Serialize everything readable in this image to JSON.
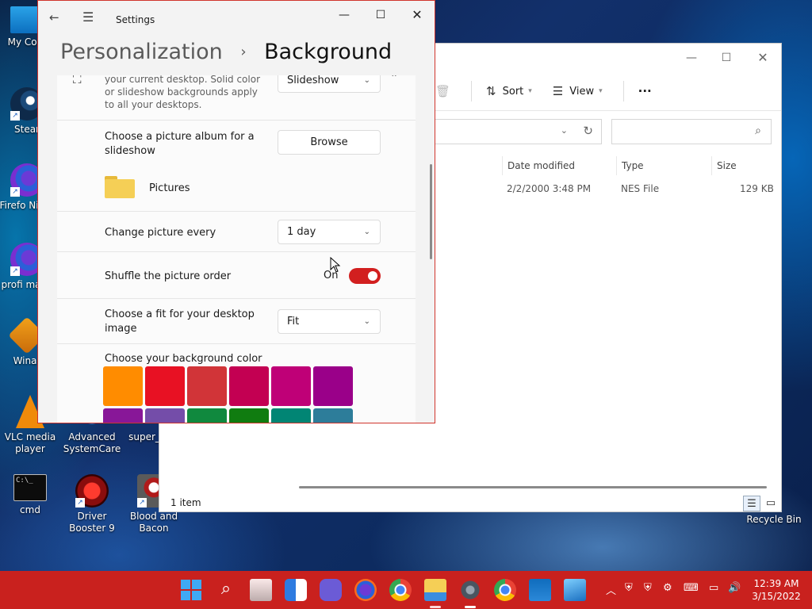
{
  "desktop": {
    "icons": [
      {
        "label": "My Com"
      },
      {
        "label": "Stear"
      },
      {
        "label": "Firefo Night"
      },
      {
        "label": "profi mana"
      },
      {
        "label": "Winar"
      },
      {
        "label": "VLC media player"
      },
      {
        "label": "Advanced SystemCare"
      },
      {
        "label": "super_"
      },
      {
        "label": "cmd"
      },
      {
        "label": "Driver Booster 9"
      },
      {
        "label": "Blood and Bacon"
      },
      {
        "label": "Recycle Bin"
      }
    ]
  },
  "explorer": {
    "toolbar": {
      "sort_label": "Sort",
      "view_label": "View",
      "more_label": "···"
    },
    "columns": {
      "date": "Date modified",
      "type": "Type",
      "size": "Size"
    },
    "row": {
      "date": "2/2/2000 3:48 PM",
      "type": "NES File",
      "size": "129 KB"
    },
    "status": "1 item"
  },
  "settings": {
    "app_title": "Settings",
    "breadcrumb": {
      "parent": "Personalization",
      "sep": "›",
      "current": "Background"
    },
    "background_card": {
      "sub": "your current desktop. Solid color or slideshow backgrounds apply to all your desktops.",
      "value": "Slideshow"
    },
    "album": {
      "label": "Choose a picture album for a slideshow",
      "button": "Browse",
      "folder": "Pictures"
    },
    "interval": {
      "label": "Change picture every",
      "value": "1 day"
    },
    "shuffle": {
      "label": "Shuffle the picture order",
      "state": "On"
    },
    "fit": {
      "label": "Choose a fit for your desktop image",
      "value": "Fit"
    },
    "color": {
      "label": "Choose your background color",
      "swatches": [
        "#ff8c00",
        "#e81123",
        "#d13438",
        "#c30052",
        "#bf0077",
        "#9a0089",
        "#881798",
        "#744da9",
        "#10893e",
        "#107c10",
        "#018574",
        "#2d7d9a"
      ]
    }
  },
  "taskbar": {
    "clock_time": "12:39 AM",
    "clock_date": "3/15/2022"
  }
}
